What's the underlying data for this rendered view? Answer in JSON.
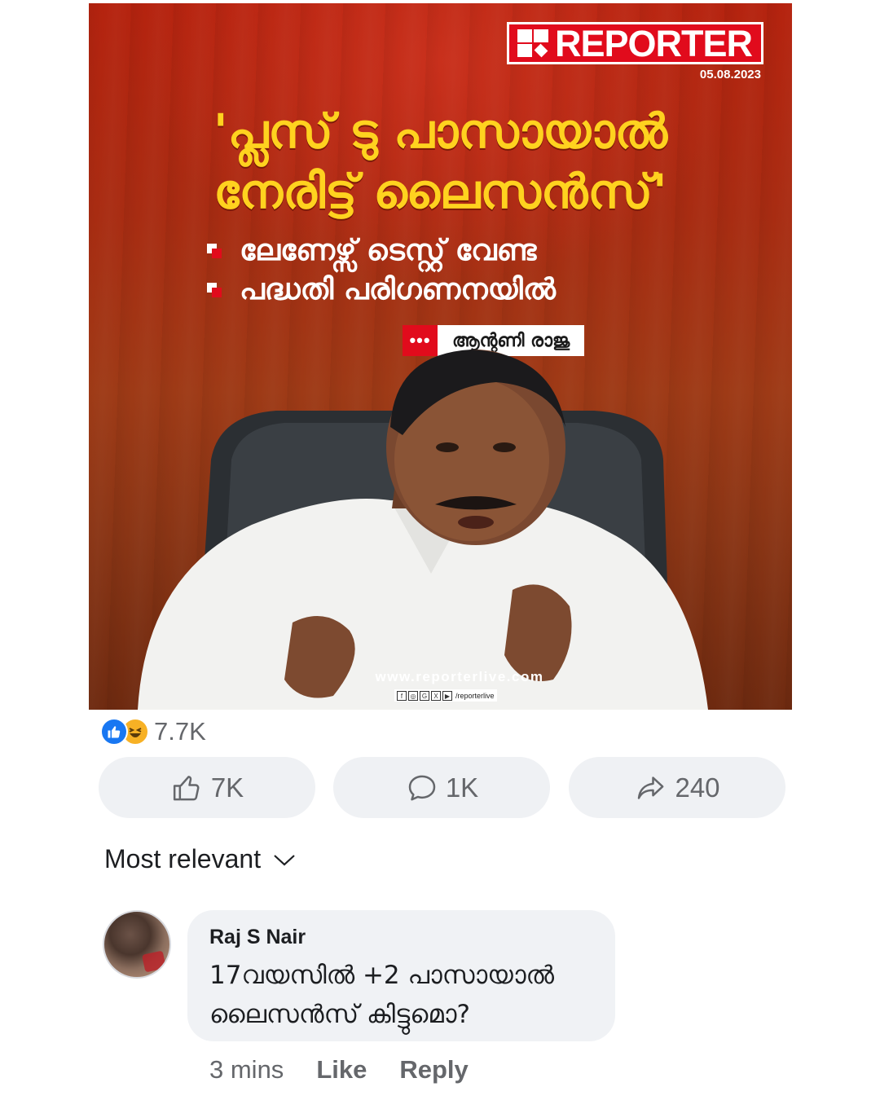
{
  "post_image": {
    "brand": "REPORTER",
    "date": "05.08.2023",
    "headline_line1": "'പ്ലസ് ടു പാസായാൽ",
    "headline_line2": "നേരിട്ട് ലൈസൻസ്'",
    "bullets": [
      "ലേണേഴ്സ് ടെസ്റ്റ് വേണ്ട",
      "പദ്ധതി പരിഗണനയിൽ"
    ],
    "name_tag_dots": "•••",
    "name_tag": "ആന്റണി രാജു",
    "website": "www.reporterlive.com",
    "social_handle": "/reporterlive",
    "social_icons": [
      "f",
      "◎",
      "G",
      "X",
      "▶"
    ]
  },
  "reactions": {
    "icons": [
      "like-icon",
      "haha-icon"
    ],
    "count": "7.7K"
  },
  "actions": {
    "like_count": "7K",
    "comment_count": "1K",
    "share_count": "240"
  },
  "comments": {
    "sort_label": "Most relevant",
    "items": [
      {
        "author": "Raj S Nair",
        "text_line1": "17വയസിൽ +2 പാസായാൽ",
        "text_line2": "ലൈസൻസ് കിട്ടുമൊ?",
        "time": "3 mins",
        "like_label": "Like",
        "reply_label": "Reply"
      }
    ]
  }
}
